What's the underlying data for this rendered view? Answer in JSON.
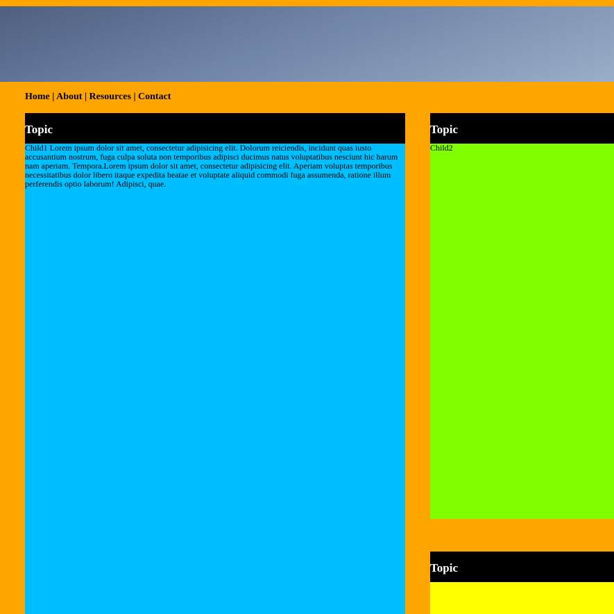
{
  "nav": {
    "home": "Home",
    "about": "About",
    "resources": "Resources",
    "contact": "Contact",
    "separator": " | "
  },
  "panels": {
    "main": {
      "title": "Topic",
      "body": "Child1 Lorem ipsum dolor sit amet, consectetur adipisicing elit. Dolorum reiciendis, incidunt quas iusto accusantium nostrum, fuga culpa soluta non temporibus adipisci ducimus natus voluptatibus nesciunt hic harum nam aperiam. Tempora.Lorem ipsum dolor sit amet, consectetur adipisicing elit. Aperiam voluptas temporibus necessitatibus dolor libero itaque expedita beatae et voluptate aliquid commodi fuga assumenda, ratione illum perferendis optio laborum! Adipisci, quae."
    },
    "side1": {
      "title": "Topic",
      "body": "Child2"
    },
    "side2": {
      "title": "Topic",
      "body": ""
    }
  },
  "colors": {
    "page_background": "#FFA500",
    "header_background": "#000000",
    "main_panel": "#00BFFF",
    "side1_panel": "#7FFF00",
    "side2_panel": "#FFFF00"
  }
}
